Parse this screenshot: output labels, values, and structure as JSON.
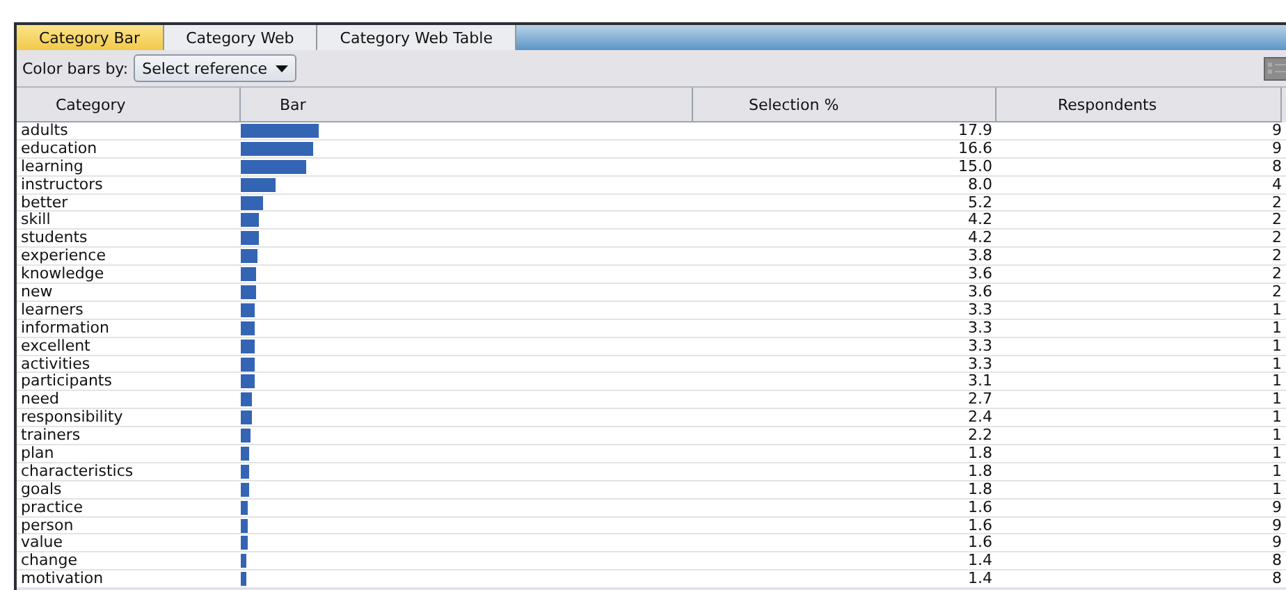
{
  "tabs": [
    {
      "label": "Category Bar",
      "selected": true
    },
    {
      "label": "Category Web",
      "selected": false
    },
    {
      "label": "Category Web Table",
      "selected": false
    }
  ],
  "toolbar": {
    "label": "Color bars by:",
    "dropdown": "Select reference"
  },
  "table": {
    "columns": [
      "Category",
      "Bar",
      "Selection %",
      "Respondents"
    ],
    "rows": [
      {
        "category": "adults",
        "selection": "17.9",
        "respondents": "9"
      },
      {
        "category": "education",
        "selection": "16.6",
        "respondents": "9"
      },
      {
        "category": "learning",
        "selection": "15.0",
        "respondents": "8"
      },
      {
        "category": "instructors",
        "selection": "8.0",
        "respondents": "4"
      },
      {
        "category": "better",
        "selection": "5.2",
        "respondents": "2"
      },
      {
        "category": "skill",
        "selection": "4.2",
        "respondents": "2"
      },
      {
        "category": "students",
        "selection": "4.2",
        "respondents": "2"
      },
      {
        "category": "experience",
        "selection": "3.8",
        "respondents": "2"
      },
      {
        "category": "knowledge",
        "selection": "3.6",
        "respondents": "2"
      },
      {
        "category": "new",
        "selection": "3.6",
        "respondents": "2"
      },
      {
        "category": "learners",
        "selection": "3.3",
        "respondents": "1"
      },
      {
        "category": "information",
        "selection": "3.3",
        "respondents": "1"
      },
      {
        "category": "excellent",
        "selection": "3.3",
        "respondents": "1"
      },
      {
        "category": "activities",
        "selection": "3.3",
        "respondents": "1"
      },
      {
        "category": "participants",
        "selection": "3.1",
        "respondents": "1"
      },
      {
        "category": "need",
        "selection": "2.7",
        "respondents": "1"
      },
      {
        "category": "responsibility",
        "selection": "2.4",
        "respondents": "1"
      },
      {
        "category": "trainers",
        "selection": "2.2",
        "respondents": "1"
      },
      {
        "category": "plan",
        "selection": "1.8",
        "respondents": "1"
      },
      {
        "category": "characteristics",
        "selection": "1.8",
        "respondents": "1"
      },
      {
        "category": "goals",
        "selection": "1.8",
        "respondents": "1"
      },
      {
        "category": "practice",
        "selection": "1.6",
        "respondents": "9"
      },
      {
        "category": "person",
        "selection": "1.6",
        "respondents": "9"
      },
      {
        "category": "value",
        "selection": "1.6",
        "respondents": "9"
      },
      {
        "category": "change",
        "selection": "1.4",
        "respondents": "8"
      },
      {
        "category": "motivation",
        "selection": "1.4",
        "respondents": "8"
      }
    ]
  }
}
